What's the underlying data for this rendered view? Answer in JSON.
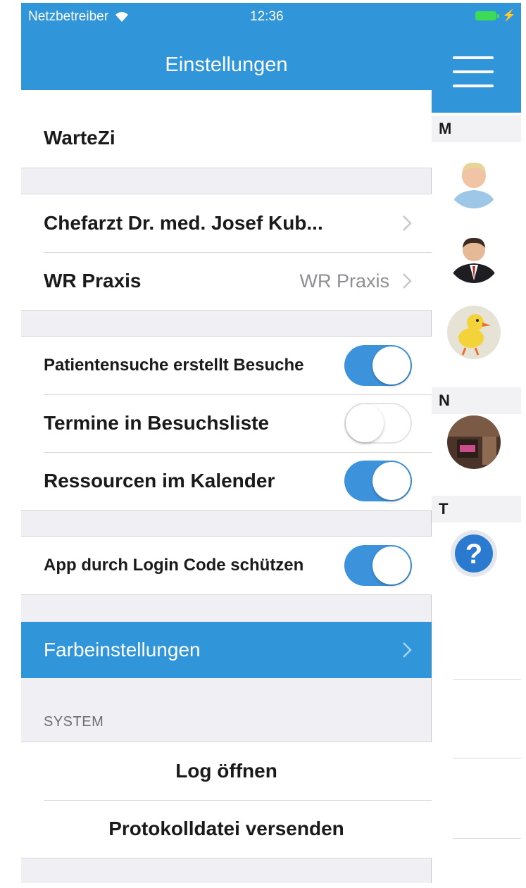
{
  "status_bar": {
    "carrier": "Netzbetreiber",
    "time": "12:36"
  },
  "navbar": {
    "title": "Einstellungen"
  },
  "account": {
    "name": "WarteZi"
  },
  "practice": {
    "doctor": "Chefarzt Dr. med. Josef Kub...",
    "practice_label": "WR Praxis",
    "practice_value": "WR Praxis"
  },
  "toggles": [
    {
      "label": "Patientensuche erstellt Besuche",
      "on": true
    },
    {
      "label": "Termine in Besuchsliste",
      "on": false
    },
    {
      "label": "Ressourcen im Kalender",
      "on": true
    }
  ],
  "security": {
    "label": "App durch Login Code schützen",
    "on": true
  },
  "colors_cell": {
    "label": "Farbeinstellungen"
  },
  "system": {
    "header": "SYSTEM",
    "open_log": "Log öffnen",
    "send_protocol": "Protokolldatei versenden"
  },
  "contacts": {
    "sections": [
      "M",
      "N",
      "T"
    ]
  },
  "theme": {
    "accent": "#3196d9",
    "toggle_on": "#3c93dc",
    "background": "#efeff4"
  }
}
